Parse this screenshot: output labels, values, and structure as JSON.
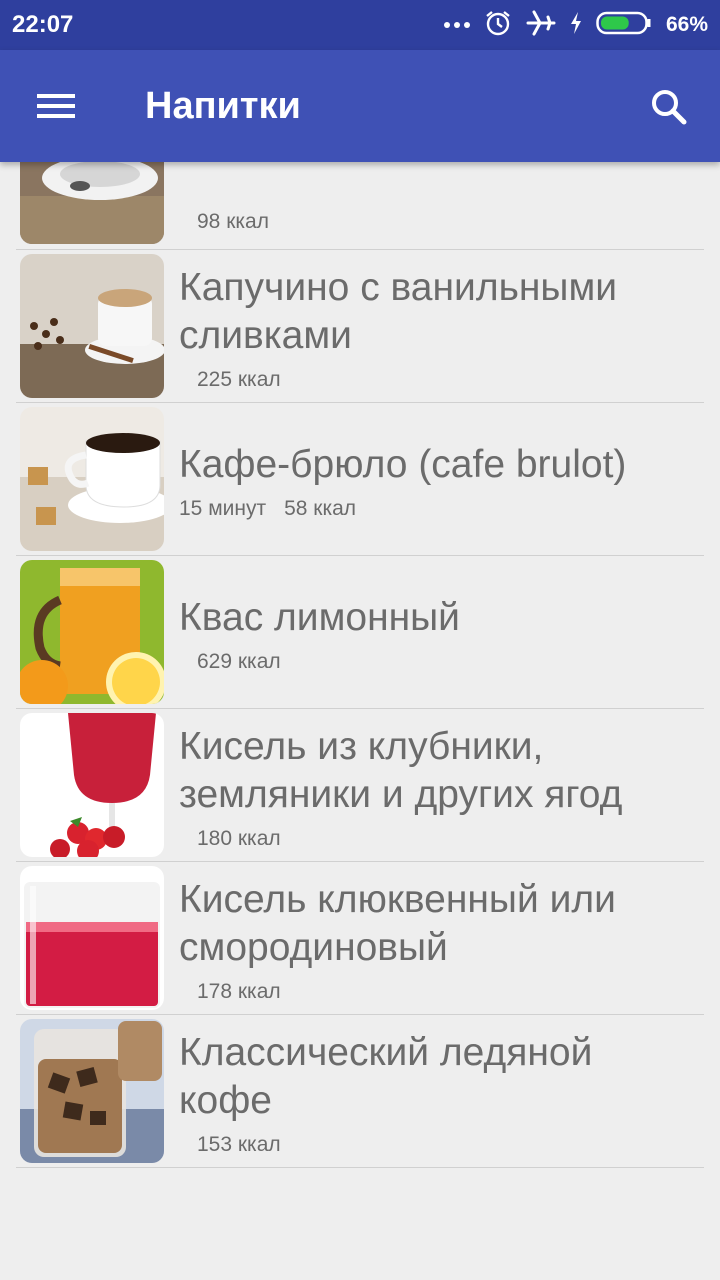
{
  "status_bar": {
    "time": "22:07",
    "battery_percent": "66%",
    "battery_level": 0.66,
    "icons": [
      "more-dots-icon",
      "alarm-icon",
      "airplane-mode-icon",
      "charging-bolt-icon",
      "battery-icon"
    ]
  },
  "app_bar": {
    "title": "Напитки",
    "menu_icon": "menu-icon",
    "search_icon": "search-icon"
  },
  "recipes": [
    {
      "title": "",
      "time": "",
      "kcal": "98 ккал"
    },
    {
      "title": "Капучино с ванильными сливками",
      "time": "",
      "kcal": "225 ккал"
    },
    {
      "title": "Кафе-брюло (cafe brulot)",
      "time": "15 минут",
      "kcal": "58 ккал"
    },
    {
      "title": "Квас лимонный",
      "time": "",
      "kcal": "629 ккал"
    },
    {
      "title": "Кисель из клубники, земляники и других ягод",
      "time": "",
      "kcal": "180 ккал"
    },
    {
      "title": "Кисель клюквенный или смородиновый",
      "time": "",
      "kcal": "178 ккал"
    },
    {
      "title": "Классический ледяной кофе",
      "time": "",
      "kcal": "153 ккал"
    }
  ],
  "colors": {
    "status_bar": "#2f3f9e",
    "app_bar": "#3f51b5",
    "background": "#eeeeee",
    "text": "#6b6b6b"
  }
}
